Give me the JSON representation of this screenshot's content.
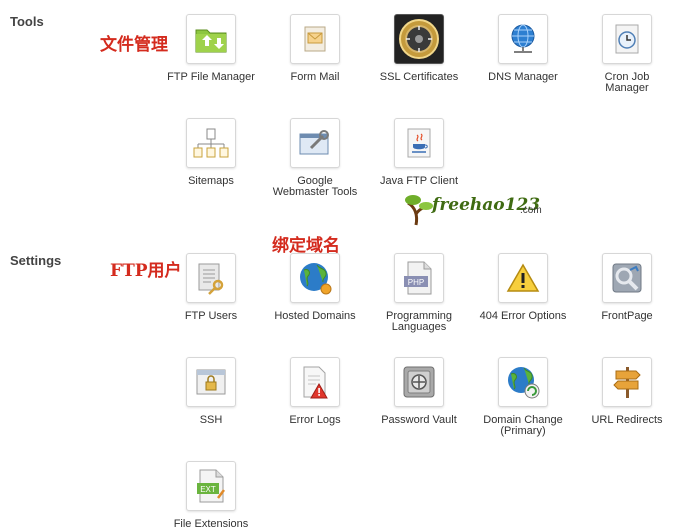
{
  "sections": {
    "tools": "Tools",
    "settings": "Settings"
  },
  "annotations": {
    "file_manager": "文件管理",
    "ftp_users": "FTP用户",
    "bind_domain": "绑定域名"
  },
  "watermark": {
    "text": "freehao123",
    "suffix": ".com"
  },
  "tools": {
    "ftp_file_manager": "FTP File Manager",
    "form_mail": "Form Mail",
    "ssl_certificates": "SSL Certificates",
    "dns_manager": "DNS Manager",
    "cron_job_manager_line1": "Cron Job",
    "cron_job_manager_line2": "Manager",
    "sitemaps": "Sitemaps",
    "google_webmaster_line1": "Google",
    "google_webmaster_line2": "Webmaster Tools",
    "java_ftp_client": "Java FTP Client"
  },
  "settings": {
    "ftp_users": "FTP Users",
    "hosted_domains": "Hosted Domains",
    "programming_languages_line1": "Programming",
    "programming_languages_line2": "Languages",
    "error_options_404": "404 Error Options",
    "frontpage": "FrontPage",
    "ssh": "SSH",
    "error_logs": "Error Logs",
    "password_vault": "Password Vault",
    "domain_change_line1": "Domain Change",
    "domain_change_line2": "(Primary)",
    "url_redirects": "URL Redirects",
    "file_extensions": "File Extensions"
  },
  "icon_labels": {
    "php": "PHP",
    "ext": "EXT"
  },
  "colors": {
    "annotation": "#d42b1e",
    "section_title": "#444444",
    "watermark_green": "#3f6b12"
  }
}
